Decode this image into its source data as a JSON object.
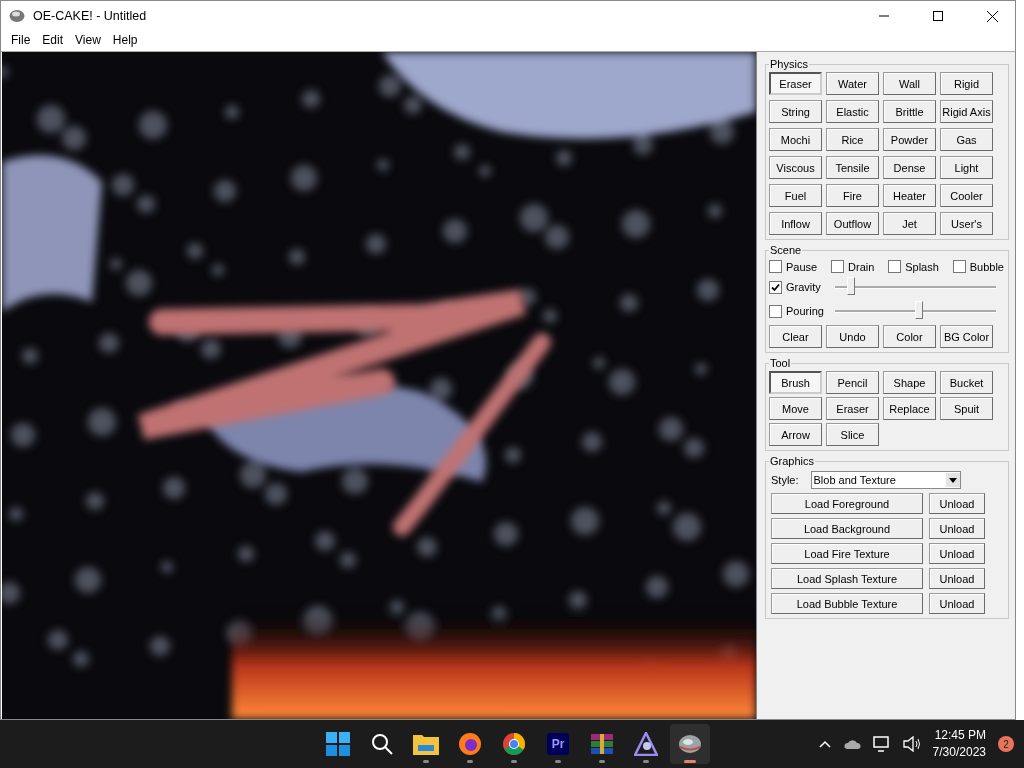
{
  "window": {
    "title": "OE-CAKE! - Untitled"
  },
  "menu": [
    "File",
    "Edit",
    "View",
    "Help"
  ],
  "physics": {
    "title": "Physics",
    "buttons": [
      {
        "label": "Eraser",
        "selected": true
      },
      {
        "label": "Water",
        "selected": false
      },
      {
        "label": "Wall",
        "selected": false
      },
      {
        "label": "Rigid",
        "selected": false
      },
      {
        "label": "String",
        "selected": false
      },
      {
        "label": "Elastic",
        "selected": false
      },
      {
        "label": "Brittle",
        "selected": false
      },
      {
        "label": "Rigid Axis",
        "selected": false
      },
      {
        "label": "Mochi",
        "selected": false
      },
      {
        "label": "Rice",
        "selected": false
      },
      {
        "label": "Powder",
        "selected": false
      },
      {
        "label": "Gas",
        "selected": false
      },
      {
        "label": "Viscous",
        "selected": false
      },
      {
        "label": "Tensile",
        "selected": false
      },
      {
        "label": "Dense",
        "selected": false
      },
      {
        "label": "Light",
        "selected": false
      },
      {
        "label": "Fuel",
        "selected": false
      },
      {
        "label": "Fire",
        "selected": false
      },
      {
        "label": "Heater",
        "selected": false
      },
      {
        "label": "Cooler",
        "selected": false
      },
      {
        "label": "Inflow",
        "selected": false
      },
      {
        "label": "Outflow",
        "selected": false
      },
      {
        "label": "Jet",
        "selected": false
      },
      {
        "label": "User's",
        "selected": false
      }
    ]
  },
  "scene": {
    "title": "Scene",
    "checkboxes": [
      {
        "label": "Pause",
        "checked": false
      },
      {
        "label": "Drain",
        "checked": false
      },
      {
        "label": "Splash",
        "checked": false
      },
      {
        "label": "Bubble",
        "checked": false
      }
    ],
    "sliders": [
      {
        "label": "Gravity",
        "checked": true,
        "level": 0.1
      },
      {
        "label": "Pouring",
        "checked": false,
        "level": 0.52
      }
    ],
    "buttons": [
      "Clear",
      "Undo",
      "Color",
      "BG Color"
    ]
  },
  "tool": {
    "title": "Tool",
    "buttons": [
      {
        "label": "Brush",
        "selected": true
      },
      {
        "label": "Pencil",
        "selected": false
      },
      {
        "label": "Shape",
        "selected": false
      },
      {
        "label": "Bucket",
        "selected": false
      },
      {
        "label": "Move",
        "selected": false
      },
      {
        "label": "Eraser",
        "selected": false
      },
      {
        "label": "Replace",
        "selected": false
      },
      {
        "label": "Spuit",
        "selected": false
      },
      {
        "label": "Arrow",
        "selected": false
      },
      {
        "label": "Slice",
        "selected": false
      }
    ]
  },
  "graphics": {
    "title": "Graphics",
    "style_label": "Style:",
    "style_value": "Blob and Texture",
    "rows": [
      {
        "load": "Load Foreground",
        "unload": "Unload"
      },
      {
        "load": "Load Background",
        "unload": "Unload"
      },
      {
        "load": "Load Fire Texture",
        "unload": "Unload"
      },
      {
        "load": "Load Splash Texture",
        "unload": "Unload"
      },
      {
        "load": "Load Bubble Texture",
        "unload": "Unload"
      }
    ]
  },
  "taskbar": {
    "apps": [
      {
        "kind": "start",
        "running": false,
        "active": false
      },
      {
        "kind": "search",
        "running": false,
        "active": false
      },
      {
        "kind": "folder",
        "running": true,
        "active": false
      },
      {
        "kind": "firefox",
        "running": true,
        "active": false
      },
      {
        "kind": "chrome",
        "running": true,
        "active": false
      },
      {
        "kind": "premiere",
        "label": "Pr",
        "running": true,
        "active": false
      },
      {
        "kind": "archive",
        "running": true,
        "active": false
      },
      {
        "kind": "letter",
        "running": true,
        "active": false
      },
      {
        "kind": "cake",
        "running": true,
        "active": true
      }
    ],
    "time": "12:45 PM",
    "date": "7/30/2023",
    "notifications": "2"
  }
}
